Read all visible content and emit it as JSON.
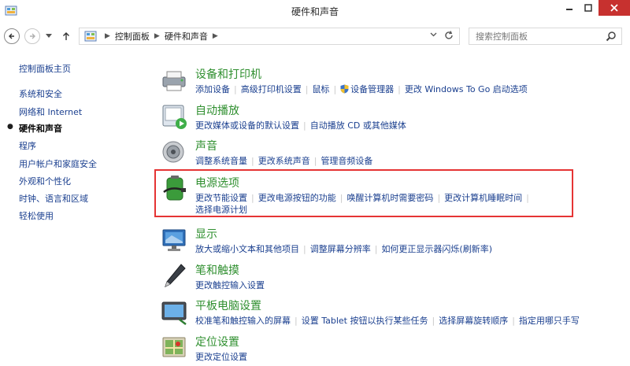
{
  "window": {
    "title": "硬件和声音"
  },
  "address": {
    "crumbs": [
      "控制面板",
      "硬件和声音"
    ]
  },
  "search": {
    "placeholder": "搜索控制面板"
  },
  "left_nav": {
    "home": "控制面板主页",
    "items": [
      {
        "label": "系统和安全",
        "active": false
      },
      {
        "label": "网络和 Internet",
        "active": false
      },
      {
        "label": "硬件和声音",
        "active": true
      },
      {
        "label": "程序",
        "active": false
      },
      {
        "label": "用户帐户和家庭安全",
        "active": false
      },
      {
        "label": "外观和个性化",
        "active": false
      },
      {
        "label": "时钟、语言和区域",
        "active": false
      },
      {
        "label": "轻松使用",
        "active": false
      }
    ]
  },
  "categories": [
    {
      "title": "设备和打印机",
      "links": [
        "添加设备",
        "高级打印机设置",
        "鼠标",
        "设备管理器",
        "更改 Windows To Go 启动选项"
      ]
    },
    {
      "title": "自动播放",
      "links": [
        "更改媒体或设备的默认设置",
        "自动播放 CD 或其他媒体"
      ]
    },
    {
      "title": "声音",
      "links": [
        "调整系统音量",
        "更改系统声音",
        "管理音频设备"
      ]
    },
    {
      "title": "电源选项",
      "links": [
        "更改节能设置",
        "更改电源按钮的功能",
        "唤醒计算机时需要密码",
        "更改计算机睡眠时间"
      ],
      "links2": [
        "选择电源计划"
      ]
    },
    {
      "title": "显示",
      "links": [
        "放大或缩小文本和其他项目",
        "调整屏幕分辨率",
        "如何更正显示器闪烁(刷新率)"
      ]
    },
    {
      "title": "笔和触摸",
      "links": [
        "更改触控输入设置"
      ]
    },
    {
      "title": "平板电脑设置",
      "links": [
        "校准笔和触控输入的屏幕",
        "设置 Tablet 按钮以执行某些任务",
        "选择屏幕旋转顺序",
        "指定用哪只手写"
      ]
    },
    {
      "title": "定位设置",
      "links": [
        "更改定位设置"
      ]
    }
  ],
  "colors": {
    "link": "#1a3f8f",
    "category_title": "#2f8f2f",
    "highlight": "#e53434",
    "close_button": "#c7312f"
  }
}
